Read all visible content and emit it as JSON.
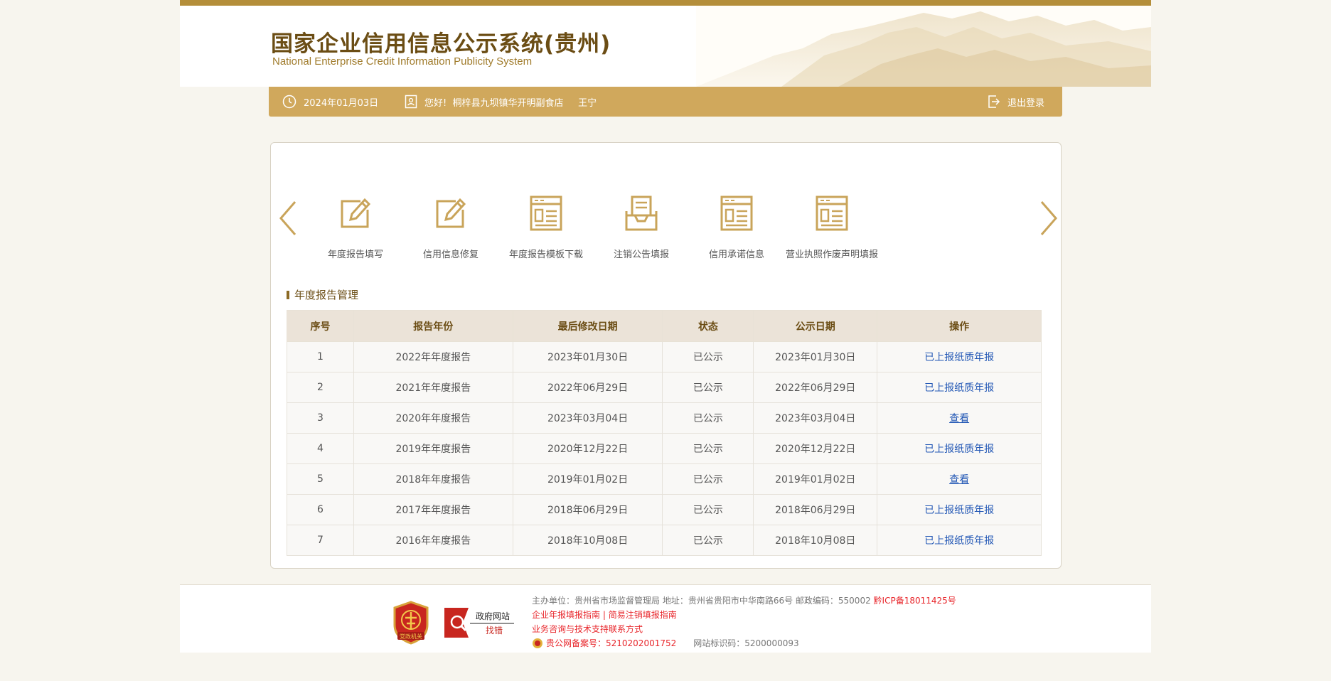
{
  "header": {
    "title": "国家企业信用信息公示系统(贵州)",
    "subtitle": "National Enterprise Credit Information Publicity System"
  },
  "infobar": {
    "date": "2024年01月03日",
    "greeting": "您好!  桐梓县九坝镇华开明副食店     王宁",
    "logout": "退出登录"
  },
  "quick_links": [
    {
      "label": "年度报告填写",
      "icon": "edit-report-icon"
    },
    {
      "label": "信用信息修复",
      "icon": "edit-report-icon"
    },
    {
      "label": "年度报告模板下载",
      "icon": "document-list-icon"
    },
    {
      "label": "注销公告填报",
      "icon": "inbox-document-icon"
    },
    {
      "label": "信用承诺信息",
      "icon": "document-list-icon"
    },
    {
      "label": "营业执照作废声明填报",
      "icon": "document-list-icon"
    }
  ],
  "section_title": "年度报告管理",
  "table": {
    "headers": [
      "序号",
      "报告年份",
      "最后修改日期",
      "状态",
      "公示日期",
      "操作"
    ],
    "rows": [
      {
        "no": "1",
        "year": "2022年年度报告",
        "modified": "2023年01月30日",
        "status": "已公示",
        "published": "2023年01月30日",
        "action": "已上报纸质年报"
      },
      {
        "no": "2",
        "year": "2021年年度报告",
        "modified": "2022年06月29日",
        "status": "已公示",
        "published": "2022年06月29日",
        "action": "已上报纸质年报"
      },
      {
        "no": "3",
        "year": "2020年年度报告",
        "modified": "2023年03月04日",
        "status": "已公示",
        "published": "2023年03月04日",
        "action": "查看"
      },
      {
        "no": "4",
        "year": "2019年年度报告",
        "modified": "2020年12月22日",
        "status": "已公示",
        "published": "2020年12月22日",
        "action": "已上报纸质年报"
      },
      {
        "no": "5",
        "year": "2018年年度报告",
        "modified": "2019年01月02日",
        "status": "已公示",
        "published": "2019年01月02日",
        "action": "查看"
      },
      {
        "no": "6",
        "year": "2017年年度报告",
        "modified": "2018年06月29日",
        "status": "已公示",
        "published": "2018年06月29日",
        "action": "已上报纸质年报"
      },
      {
        "no": "7",
        "year": "2016年年度报告",
        "modified": "2018年10月08日",
        "status": "已公示",
        "published": "2018年10月08日",
        "action": "已上报纸质年报"
      }
    ]
  },
  "footer": {
    "host": "主办单位：贵州省市场监督管理局 地址：贵州省贵阳市中华南路66号 邮政编码：550002",
    "icp": "黔ICP备18011425号",
    "guide1": "企业年报填报指南",
    "guide_sep": " | ",
    "guide2": "简易注销填报指南",
    "support": "业务咨询与技术支持联系方式",
    "police": "贵公网备案号：5210202001752",
    "site_id": "网站标识码：5200000093",
    "badge_text": "党政机关",
    "findbug_top": "政府网站",
    "findbug_bottom": "找错"
  },
  "colors": {
    "brand_gold": "#d0a85c",
    "title_brown": "#6b4d14",
    "link_blue": "#2257b5",
    "footer_red": "#e8262b"
  }
}
